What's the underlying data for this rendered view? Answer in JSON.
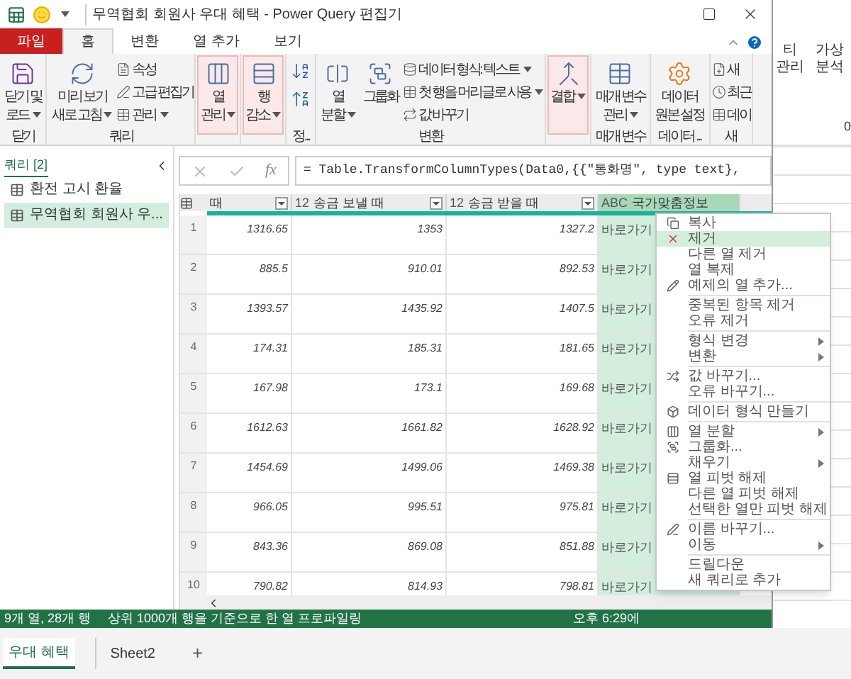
{
  "window": {
    "title": "무역협회 회원사 우대 혜택 - Power Query 편집기"
  },
  "ribbon_tabs": [
    {
      "label": "파일",
      "kind": "file",
      "selected": false
    },
    {
      "label": "홈",
      "kind": "tab",
      "selected": true
    },
    {
      "label": "변환",
      "kind": "tab",
      "selected": false
    },
    {
      "label": "열 추가",
      "kind": "tab",
      "selected": false
    },
    {
      "label": "보기",
      "kind": "tab",
      "selected": false
    }
  ],
  "ribbon_groups": [
    {
      "label": "닫기",
      "items": [
        {
          "kind": "large",
          "lines": [
            "닫기 및",
            "로드"
          ],
          "dropdown": true,
          "highlighted": false
        }
      ]
    },
    {
      "label": "쿼리",
      "items": [
        {
          "kind": "large",
          "lines": [
            "미리 보기",
            "새로 고침"
          ],
          "dropdown": true,
          "highlighted": false
        },
        {
          "kind": "small",
          "label": "속성",
          "dropdown": false
        },
        {
          "kind": "small",
          "label": "고급 편집기",
          "dropdown": false
        },
        {
          "kind": "small",
          "label": "관리",
          "dropdown": true
        }
      ]
    },
    {
      "items": [
        {
          "kind": "large",
          "lines": [
            "열",
            "관리"
          ],
          "dropdown": true,
          "highlighted": true
        }
      ]
    },
    {
      "items": [
        {
          "kind": "large",
          "lines": [
            "행",
            "감소"
          ],
          "dropdown": true,
          "highlighted": true
        }
      ]
    },
    {
      "label": "정...",
      "items": [
        {
          "kind": "sort"
        }
      ]
    },
    {
      "label": "변환",
      "items": [
        {
          "kind": "large",
          "lines": [
            "열",
            "분할"
          ],
          "dropdown": true,
          "highlighted": false
        },
        {
          "kind": "large",
          "lines": [
            "그룹화"
          ],
          "dropdown": false,
          "highlighted": false
        },
        {
          "kind": "small",
          "label": "데이터 형식: 텍스트",
          "dropdown": true
        },
        {
          "kind": "small",
          "label": "첫 행을 머리글로 사용",
          "dropdown": true
        },
        {
          "kind": "small",
          "label": "값 바꾸기",
          "dropdown": false
        }
      ]
    },
    {
      "items": [
        {
          "kind": "large",
          "lines": [
            "결합"
          ],
          "dropdown": true,
          "highlighted": true
        }
      ]
    },
    {
      "label": "매개 변수",
      "items": [
        {
          "kind": "large",
          "lines": [
            "매개 변수",
            "관리"
          ],
          "dropdown": true,
          "highlighted": false
        }
      ]
    },
    {
      "label": "데이터 ...",
      "items": [
        {
          "kind": "large",
          "lines": [
            "데이터",
            "원본 설정"
          ],
          "dropdown": false,
          "highlighted": false
        }
      ]
    },
    {
      "label": "새",
      "items": [
        {
          "kind": "small",
          "label": "새",
          "dropdown": false
        },
        {
          "kind": "small",
          "label": "최근",
          "dropdown": false
        },
        {
          "kind": "small",
          "label": "데이",
          "dropdown": false
        }
      ]
    }
  ],
  "queries": {
    "title": "쿼리 [2]",
    "items": [
      {
        "label": "환전 고시 환율",
        "selected": false
      },
      {
        "label": "무역협회 회원사 우...",
        "selected": true
      }
    ]
  },
  "formula_bar": {
    "fx": "fx",
    "formula": "= Table.TransformColumnTypes(Data0,{{\"통화명\", type text},"
  },
  "table": {
    "columns": [
      {
        "name": "때",
        "selected": false
      },
      {
        "type": "12",
        "name": "송금 보낼 때",
        "selected": false
      },
      {
        "type": "12",
        "name": "송금 받을 때",
        "selected": false
      },
      {
        "type": "ABC",
        "name": "국가맞춤정보",
        "selected": true
      }
    ],
    "rows": [
      {
        "number": "1",
        "cells": [
          "1316.65",
          "1353",
          "1327.2",
          "바로가기"
        ]
      },
      {
        "number": "2",
        "cells": [
          "885.5",
          "910.01",
          "892.53",
          "바로가기"
        ]
      },
      {
        "number": "3",
        "cells": [
          "1393.57",
          "1435.92",
          "1407.5",
          "바로가기"
        ]
      },
      {
        "number": "4",
        "cells": [
          "174.31",
          "185.31",
          "181.65",
          "바로가기"
        ]
      },
      {
        "number": "5",
        "cells": [
          "167.98",
          "173.1",
          "169.68",
          "바로가기"
        ]
      },
      {
        "number": "6",
        "cells": [
          "1612.63",
          "1661.82",
          "1628.92",
          "바로가기"
        ]
      },
      {
        "number": "7",
        "cells": [
          "1454.69",
          "1499.06",
          "1469.38",
          "바로가기"
        ]
      },
      {
        "number": "8",
        "cells": [
          "966.05",
          "995.51",
          "975.81",
          "바로가기"
        ]
      },
      {
        "number": "9",
        "cells": [
          "843.36",
          "869.08",
          "851.88",
          "바로가기"
        ]
      },
      {
        "number": "10",
        "cells": [
          "790.82",
          "814.93",
          "798.81",
          "바로가기"
        ]
      }
    ]
  },
  "status_bar": {
    "left": "9개 열, 28개 행",
    "middle": "상위 1000개 행을 기준으로 한 열 프로파일링",
    "right": "오후 6:29에"
  },
  "context_menu": [
    {
      "kind": "item",
      "label": "복사",
      "selected": false,
      "submenu": false
    },
    {
      "kind": "item",
      "label": "제거",
      "selected": true,
      "submenu": false
    },
    {
      "kind": "item",
      "label": "다른 열 제거",
      "selected": false,
      "submenu": false
    },
    {
      "kind": "item",
      "label": "열 복제",
      "selected": false,
      "submenu": false
    },
    {
      "kind": "item",
      "label": "예제의 열 추가...",
      "selected": false,
      "submenu": false
    },
    {
      "kind": "separator"
    },
    {
      "kind": "item",
      "label": "중복된 항목 제거",
      "selected": false,
      "submenu": false
    },
    {
      "kind": "item",
      "label": "오류 제거",
      "selected": false,
      "submenu": false
    },
    {
      "kind": "separator"
    },
    {
      "kind": "item",
      "label": "형식 변경",
      "selected": false,
      "submenu": true
    },
    {
      "kind": "item",
      "label": "변환",
      "selected": false,
      "submenu": true
    },
    {
      "kind": "separator"
    },
    {
      "kind": "item",
      "label": "값 바꾸기...",
      "selected": false,
      "submenu": false
    },
    {
      "kind": "item",
      "label": "오류 바꾸기...",
      "selected": false,
      "submenu": false
    },
    {
      "kind": "separator"
    },
    {
      "kind": "item",
      "label": "데이터 형식 만들기",
      "selected": false,
      "submenu": false
    },
    {
      "kind": "separator"
    },
    {
      "kind": "item",
      "label": "열 분할",
      "selected": false,
      "submenu": true
    },
    {
      "kind": "item",
      "label": "그룹화...",
      "selected": false,
      "submenu": false
    },
    {
      "kind": "item",
      "label": "채우기",
      "selected": false,
      "submenu": true
    },
    {
      "kind": "item",
      "label": "열 피벗 해제",
      "selected": false,
      "submenu": false
    },
    {
      "kind": "item",
      "label": "다른 열 피벗 해제",
      "selected": false,
      "submenu": false
    },
    {
      "kind": "item",
      "label": "선택한 열만 피벗 해제",
      "selected": false,
      "submenu": false
    },
    {
      "kind": "separator"
    },
    {
      "kind": "item",
      "label": "이름 바꾸기...",
      "selected": false,
      "submenu": false
    },
    {
      "kind": "item",
      "label": "이동",
      "selected": false,
      "submenu": true
    },
    {
      "kind": "separator"
    },
    {
      "kind": "item",
      "label": "드릴다운",
      "selected": false,
      "submenu": false
    },
    {
      "kind": "item",
      "label": "새 쿼리로 추가",
      "selected": false,
      "submenu": false
    }
  ],
  "excel_ribbon": [
    {
      "lines": [
        "티",
        "관리"
      ]
    },
    {
      "lines": [
        "가상",
        "분석"
      ]
    }
  ],
  "excel_group_label": "0",
  "sheet_tabs": [
    {
      "label": "우대 혜택",
      "selected": true
    },
    {
      "label": "Sheet2",
      "selected": false
    }
  ],
  "add_sheet": "+"
}
